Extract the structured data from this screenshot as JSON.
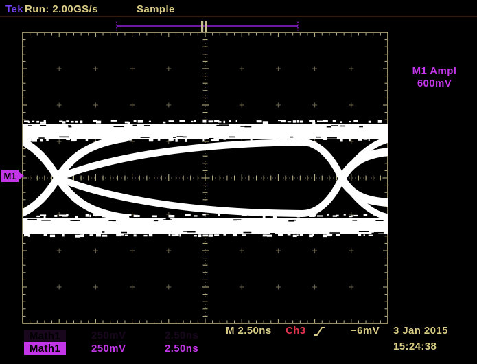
{
  "header": {
    "brand": "Tek",
    "status": "Run: 2.00GS/s",
    "acq_mode": "Sample"
  },
  "measurement_readout": {
    "source": "M1 Ampl",
    "value": "600mV"
  },
  "left_reference_marker": {
    "label": "M1"
  },
  "trigger_readout": {
    "timebase": "M 2.50ns",
    "source": "Ch3",
    "slope_icon": "rising-edge",
    "level": "−6mV"
  },
  "datetime": {
    "date": "3 Jan 2015",
    "time": "15:24:38"
  },
  "math_readout": {
    "label": "Math1",
    "vertical_scale": "250mV",
    "horizontal_scale": "2.50ns"
  },
  "colors": {
    "background": "#000000",
    "tan_text": "#d9cc86",
    "grid": "#c3ba8e",
    "grid_dim": "#6f684e",
    "violet_brand": "#7040e8",
    "magenta": "#c336e8",
    "record_bar": "#9220d8",
    "trigger_red": "#e0334c",
    "waveform_white": "#ffffff"
  }
}
